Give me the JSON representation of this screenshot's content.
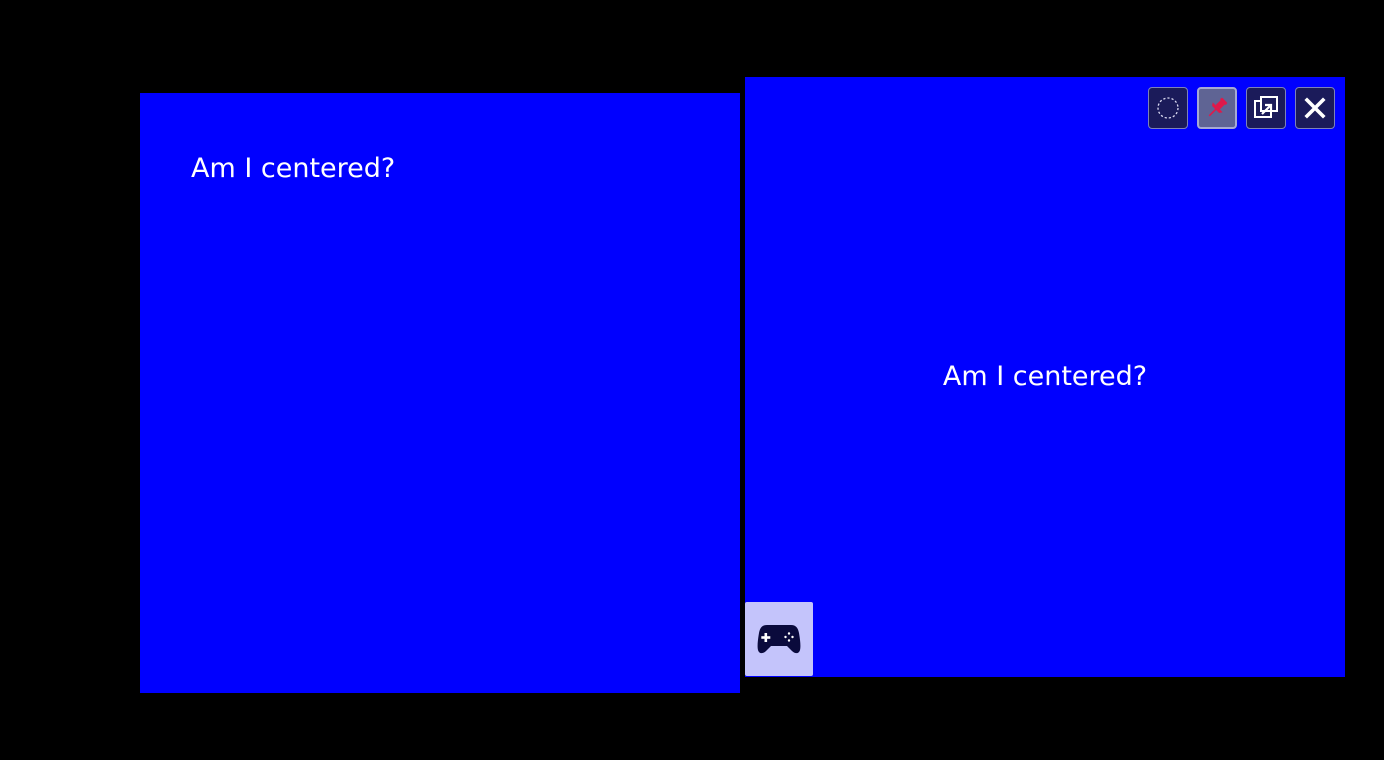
{
  "panels": {
    "left": {
      "text": "Am I centered?"
    },
    "right": {
      "text": "Am I centered?"
    }
  },
  "toolbar": {
    "buttons": [
      {
        "icon": "dashed-circle-icon",
        "state": "default"
      },
      {
        "icon": "pin-icon",
        "state": "active"
      },
      {
        "icon": "popout-icon",
        "state": "default"
      },
      {
        "icon": "close-icon",
        "state": "default"
      }
    ]
  },
  "game_button": {
    "icon": "gamepad-icon"
  },
  "colors": {
    "background": "#000000",
    "panel": "#0000ff",
    "text": "#ffffff",
    "button_bg": "#1b1b5a",
    "button_active_bg": "#5f6494",
    "pin_accent": "#e0184a",
    "game_button_bg": "#c4c4fb"
  }
}
